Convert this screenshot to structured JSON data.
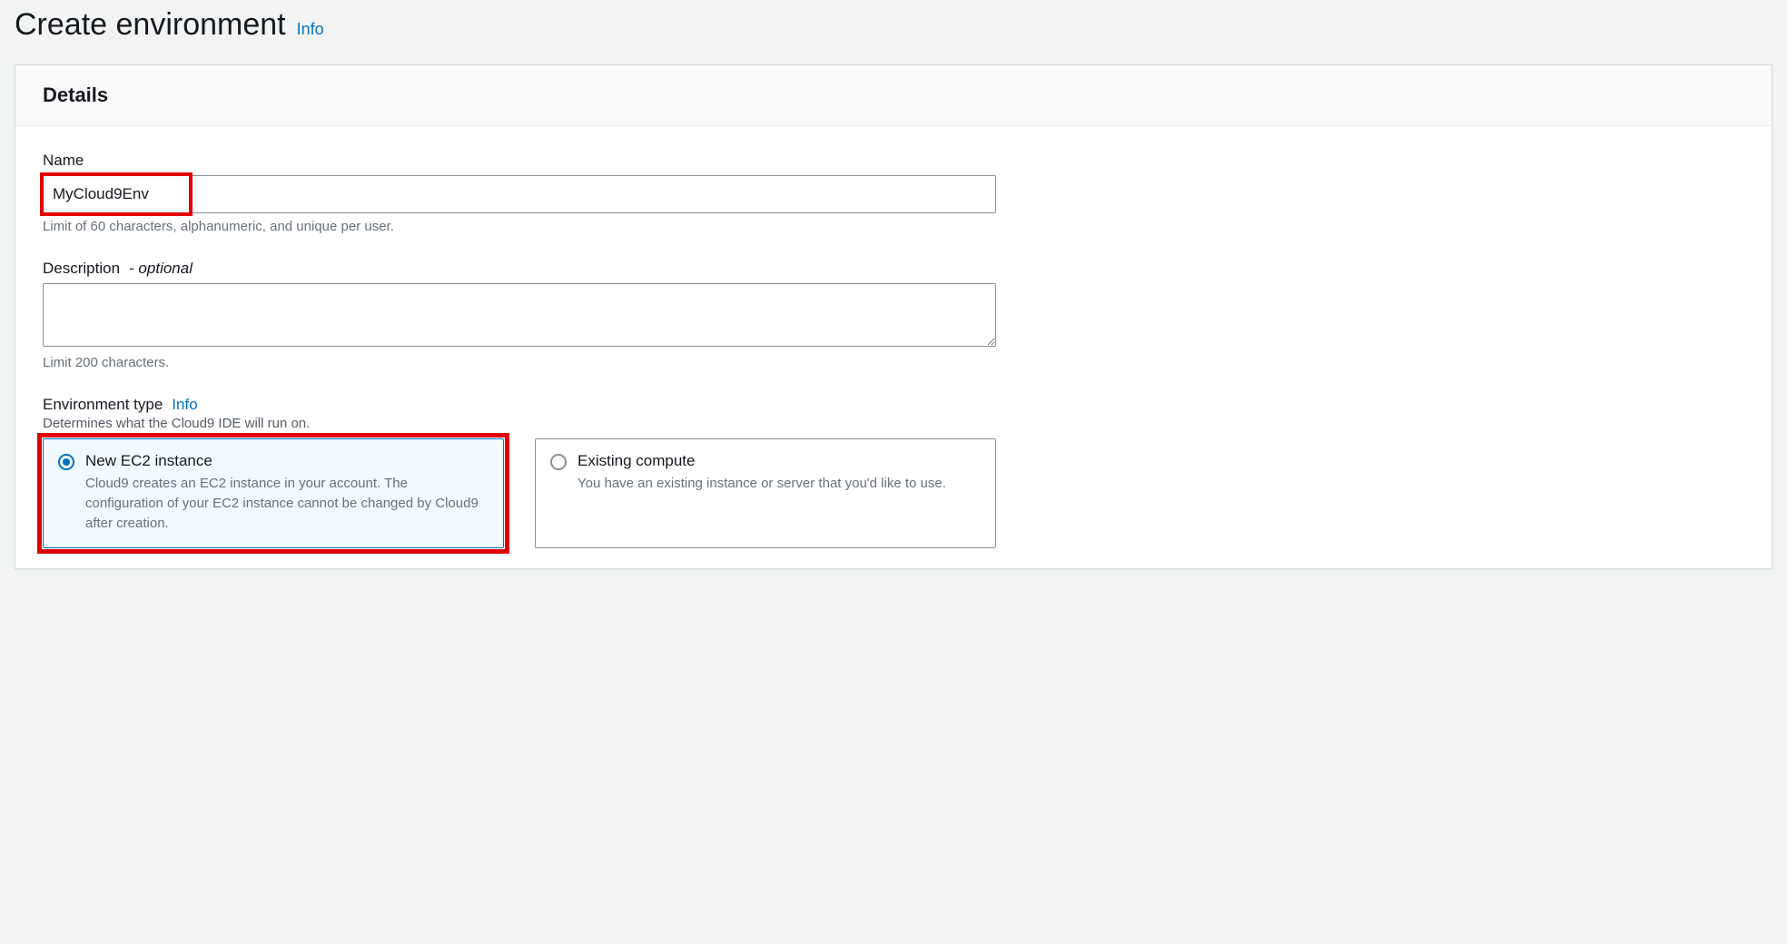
{
  "header": {
    "title": "Create environment",
    "info": "Info"
  },
  "panel": {
    "title": "Details"
  },
  "fields": {
    "name": {
      "label": "Name",
      "value": "MyCloud9Env",
      "hint": "Limit of 60 characters, alphanumeric, and unique per user."
    },
    "description": {
      "label": "Description",
      "optional_suffix": "- optional",
      "value": "",
      "hint": "Limit 200 characters."
    },
    "env_type": {
      "label": "Environment type",
      "info": "Info",
      "sub": "Determines what the Cloud9 IDE will run on.",
      "options": [
        {
          "title": "New EC2 instance",
          "desc": "Cloud9 creates an EC2 instance in your account. The configuration of your EC2 instance cannot be changed by Cloud9 after creation.",
          "selected": true
        },
        {
          "title": "Existing compute",
          "desc": "You have an existing instance or server that you'd like to use.",
          "selected": false
        }
      ]
    }
  }
}
